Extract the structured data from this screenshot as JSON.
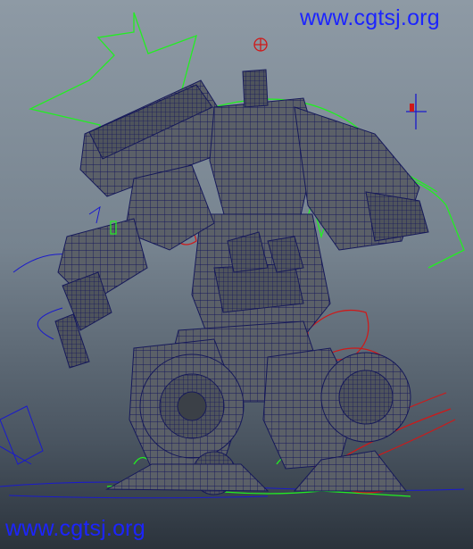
{
  "viewport": {
    "colors": {
      "background_top": "#8e9aa5",
      "background_bottom": "#2b333c",
      "mesh_wire": "#16195a",
      "mesh_fill": "#5a6068",
      "control_green": "#22ee22",
      "control_red": "#d01818",
      "control_blue": "#1a1acc"
    }
  },
  "watermarks": {
    "top": "www.cgtsj.org",
    "bottom": "www.cgtsj.org",
    "color": "#1c24ff"
  },
  "icons": [
    "locator-crosshair-icon",
    "axis-manipulator-icon"
  ]
}
